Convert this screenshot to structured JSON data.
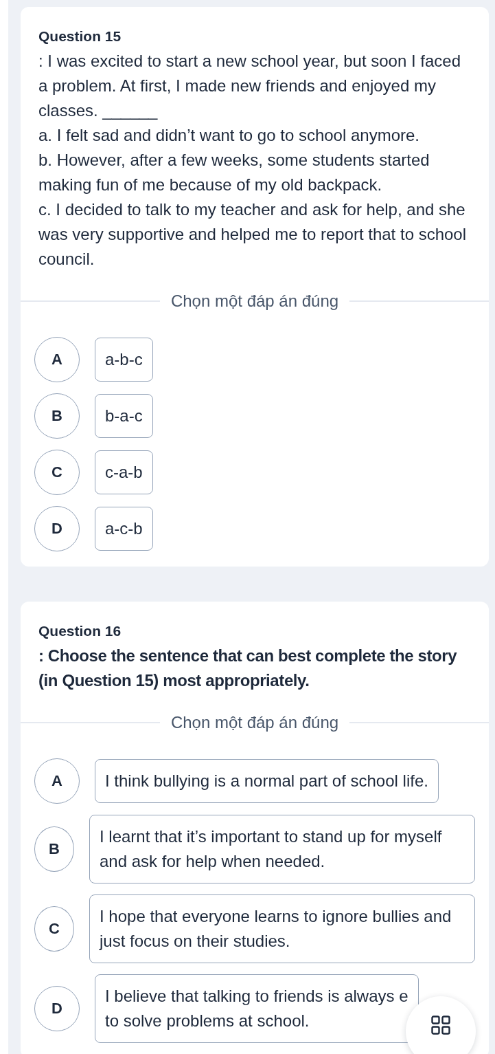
{
  "questions": [
    {
      "title": "Question 15",
      "stem_bold": false,
      "stem": ": I was excited to start a new school year, but soon I faced a problem. At first, I made new friends and enjoyed my classes. ______",
      "statements": [
        "a. I felt sad and didn’t want to go to school anymore.",
        "b. However, after a few weeks, some students started making fun of me because of my old backpack.",
        "c. I decided to talk to my teacher and ask for help, and she was very supportive and helped me to report that to school council."
      ],
      "instruction": "Chọn một đáp án đúng",
      "options": [
        {
          "letter": "A",
          "text": "a-b-c",
          "selected": false
        },
        {
          "letter": "B",
          "text": "b-a-c",
          "selected": false
        },
        {
          "letter": "C",
          "text": "c-a-b",
          "selected": false
        },
        {
          "letter": "D",
          "text": "a-c-b",
          "selected": false
        }
      ]
    },
    {
      "title": "Question 16",
      "stem_bold": true,
      "stem": ": Choose the sentence that can best complete the story (in Question 15) most appropriately.",
      "instruction": "Chọn một đáp án đúng",
      "options": [
        {
          "letter": "A",
          "text": "I think bullying is a normal part of school life.",
          "selected": false
        },
        {
          "letter": "B",
          "text": "I learnt that it’s important to stand up for myself and ask for help when needed.",
          "selected": false
        },
        {
          "letter": "C",
          "text": "I hope that everyone learns to ignore bullies and just focus on their studies.",
          "selected": false
        },
        {
          "letter": "D",
          "text": "I believe that talking to friends is always e\nto solve problems at school.",
          "selected": false
        }
      ]
    }
  ]
}
